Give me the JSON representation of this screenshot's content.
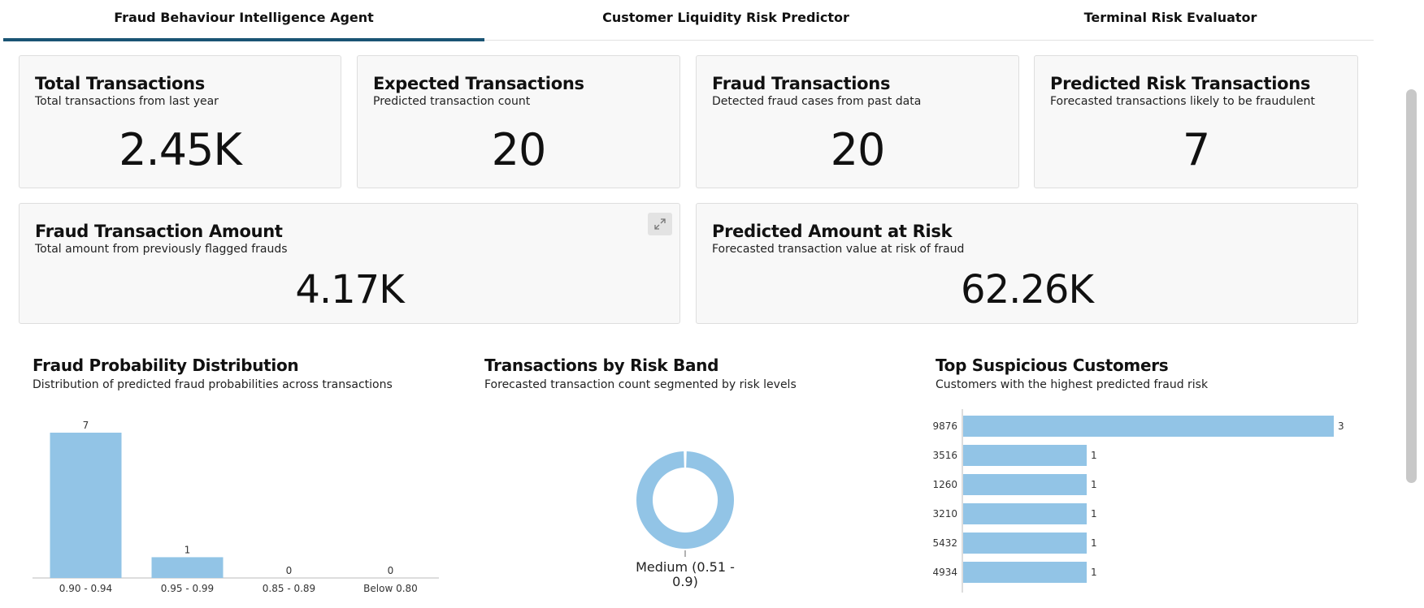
{
  "tabs": [
    {
      "label": "Fraud Behaviour Intelligence Agent",
      "active": true
    },
    {
      "label": "Customer Liquidity Risk Predictor",
      "active": false
    },
    {
      "label": "Terminal Risk Evaluator",
      "active": false
    }
  ],
  "kpis": {
    "total_transactions": {
      "title": "Total Transactions",
      "subtitle": "Total transactions from last year",
      "value": "2.45K"
    },
    "expected_transactions": {
      "title": "Expected Transactions",
      "subtitle": "Predicted transaction count",
      "value": "20"
    },
    "fraud_transactions": {
      "title": "Fraud Transactions",
      "subtitle": "Detected fraud cases from past data",
      "value": "20"
    },
    "predicted_risk_transactions": {
      "title": "Predicted Risk Transactions",
      "subtitle": "Forecasted transactions likely to be fraudulent",
      "value": "7"
    },
    "fraud_transaction_amount": {
      "title": "Fraud Transaction Amount",
      "subtitle": "Total amount from previously flagged frauds",
      "value": "4.17K"
    },
    "predicted_amount_at_risk": {
      "title": "Predicted Amount at Risk",
      "subtitle": "Forecasted transaction value at risk of fraud",
      "value": "62.26K"
    }
  },
  "charts": {
    "fraud_probability": {
      "title": "Fraud Probability Distribution",
      "subtitle": "Distribution of predicted fraud probabilities across transactions"
    },
    "risk_band": {
      "title": "Transactions by Risk Band",
      "subtitle": "Forecasted transaction count segmented by risk levels",
      "label_line1": "Medium (0.51 -",
      "label_line2": "0.9)"
    },
    "top_customers": {
      "title": "Top Suspicious Customers",
      "subtitle": "Customers with the highest predicted fraud risk"
    }
  },
  "colors": {
    "accent": "#1a5474",
    "bar": "#92c4e6"
  },
  "chart_data": [
    {
      "type": "bar",
      "categories": [
        "0.90 - 0.94",
        "0.95 - 0.99",
        "0.85 - 0.89",
        "Below 0.80"
      ],
      "values": [
        7,
        1,
        0,
        0
      ],
      "ylim": [
        0,
        7
      ]
    },
    {
      "type": "pie",
      "categories": [
        "Medium (0.51 - 0.9)"
      ],
      "values": [
        1
      ]
    },
    {
      "type": "bar",
      "orientation": "horizontal",
      "categories": [
        "9876",
        "3516",
        "1260",
        "3210",
        "5432",
        "4934"
      ],
      "values": [
        3,
        1,
        1,
        1,
        1,
        1
      ],
      "xlim": [
        0,
        3
      ]
    }
  ]
}
